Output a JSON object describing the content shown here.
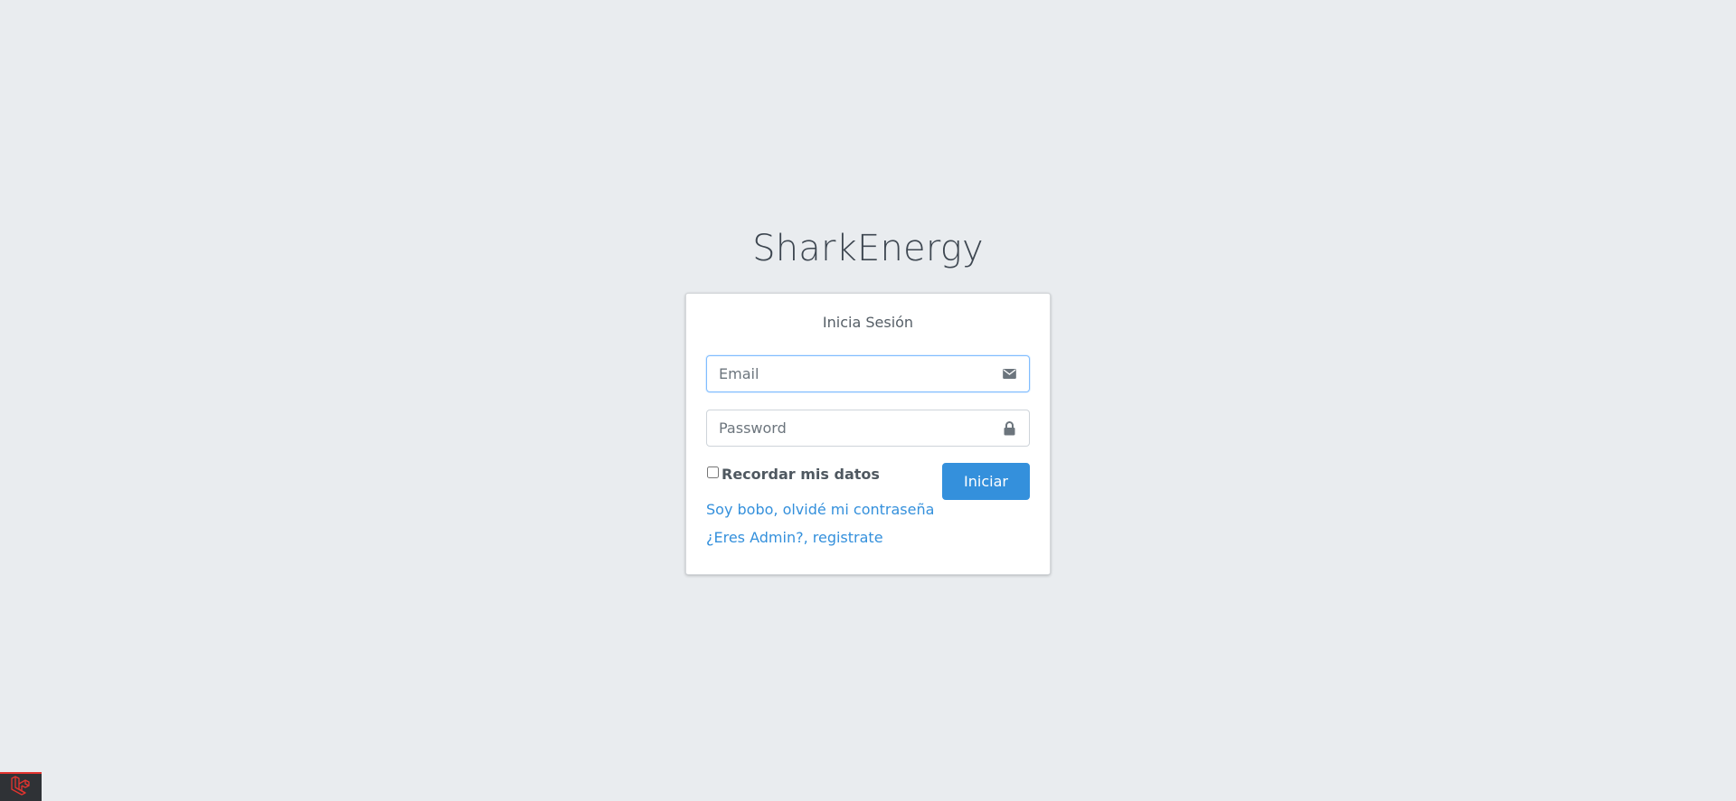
{
  "app": {
    "logo_text": "SharkEnergy"
  },
  "login": {
    "message": "Inicia Sesión",
    "email": {
      "placeholder": "Email",
      "value": "",
      "icon": "envelope-icon"
    },
    "password": {
      "placeholder": "Password",
      "value": "",
      "icon": "lock-icon"
    },
    "remember_label": "Recordar mis datos",
    "remember_checked": false,
    "submit_label": "Iniciar",
    "forgot_link": "Soy bobo, olvidé mi contraseña",
    "register_link": "¿Eres Admin?, registrate"
  },
  "colors": {
    "background": "#e9ecef",
    "primary": "#3490dc",
    "debugbar_accent": "#e3342f"
  },
  "debugbar": {
    "icon": "laravel-logo-icon"
  }
}
